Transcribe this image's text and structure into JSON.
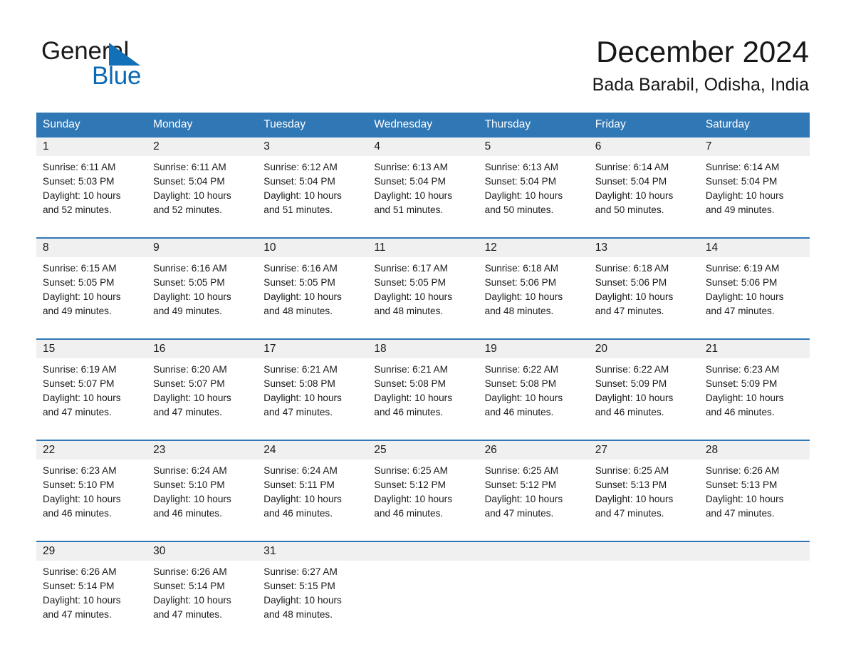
{
  "brand": {
    "name_part1": "General",
    "name_part2": "Blue",
    "triangle_color": "#1270b8",
    "blue_text_color": "#0b68b4"
  },
  "header": {
    "month_title": "December 2024",
    "location": "Bada Barabil, Odisha, India"
  },
  "theme": {
    "header_blue": "#2f77b5",
    "daynum_band": "#f0f0f0",
    "divider_blue": "#2f77b5",
    "text": "#1a1a1a"
  },
  "calendar": {
    "weekday_headers": [
      "Sunday",
      "Monday",
      "Tuesday",
      "Wednesday",
      "Thursday",
      "Friday",
      "Saturday"
    ],
    "weeks": [
      [
        {
          "day": "1",
          "sunrise": "Sunrise: 6:11 AM",
          "sunset": "Sunset: 5:03 PM",
          "daylight_line1": "Daylight: 10 hours",
          "daylight_line2": "and 52 minutes."
        },
        {
          "day": "2",
          "sunrise": "Sunrise: 6:11 AM",
          "sunset": "Sunset: 5:04 PM",
          "daylight_line1": "Daylight: 10 hours",
          "daylight_line2": "and 52 minutes."
        },
        {
          "day": "3",
          "sunrise": "Sunrise: 6:12 AM",
          "sunset": "Sunset: 5:04 PM",
          "daylight_line1": "Daylight: 10 hours",
          "daylight_line2": "and 51 minutes."
        },
        {
          "day": "4",
          "sunrise": "Sunrise: 6:13 AM",
          "sunset": "Sunset: 5:04 PM",
          "daylight_line1": "Daylight: 10 hours",
          "daylight_line2": "and 51 minutes."
        },
        {
          "day": "5",
          "sunrise": "Sunrise: 6:13 AM",
          "sunset": "Sunset: 5:04 PM",
          "daylight_line1": "Daylight: 10 hours",
          "daylight_line2": "and 50 minutes."
        },
        {
          "day": "6",
          "sunrise": "Sunrise: 6:14 AM",
          "sunset": "Sunset: 5:04 PM",
          "daylight_line1": "Daylight: 10 hours",
          "daylight_line2": "and 50 minutes."
        },
        {
          "day": "7",
          "sunrise": "Sunrise: 6:14 AM",
          "sunset": "Sunset: 5:04 PM",
          "daylight_line1": "Daylight: 10 hours",
          "daylight_line2": "and 49 minutes."
        }
      ],
      [
        {
          "day": "8",
          "sunrise": "Sunrise: 6:15 AM",
          "sunset": "Sunset: 5:05 PM",
          "daylight_line1": "Daylight: 10 hours",
          "daylight_line2": "and 49 minutes."
        },
        {
          "day": "9",
          "sunrise": "Sunrise: 6:16 AM",
          "sunset": "Sunset: 5:05 PM",
          "daylight_line1": "Daylight: 10 hours",
          "daylight_line2": "and 49 minutes."
        },
        {
          "day": "10",
          "sunrise": "Sunrise: 6:16 AM",
          "sunset": "Sunset: 5:05 PM",
          "daylight_line1": "Daylight: 10 hours",
          "daylight_line2": "and 48 minutes."
        },
        {
          "day": "11",
          "sunrise": "Sunrise: 6:17 AM",
          "sunset": "Sunset: 5:05 PM",
          "daylight_line1": "Daylight: 10 hours",
          "daylight_line2": "and 48 minutes."
        },
        {
          "day": "12",
          "sunrise": "Sunrise: 6:18 AM",
          "sunset": "Sunset: 5:06 PM",
          "daylight_line1": "Daylight: 10 hours",
          "daylight_line2": "and 48 minutes."
        },
        {
          "day": "13",
          "sunrise": "Sunrise: 6:18 AM",
          "sunset": "Sunset: 5:06 PM",
          "daylight_line1": "Daylight: 10 hours",
          "daylight_line2": "and 47 minutes."
        },
        {
          "day": "14",
          "sunrise": "Sunrise: 6:19 AM",
          "sunset": "Sunset: 5:06 PM",
          "daylight_line1": "Daylight: 10 hours",
          "daylight_line2": "and 47 minutes."
        }
      ],
      [
        {
          "day": "15",
          "sunrise": "Sunrise: 6:19 AM",
          "sunset": "Sunset: 5:07 PM",
          "daylight_line1": "Daylight: 10 hours",
          "daylight_line2": "and 47 minutes."
        },
        {
          "day": "16",
          "sunrise": "Sunrise: 6:20 AM",
          "sunset": "Sunset: 5:07 PM",
          "daylight_line1": "Daylight: 10 hours",
          "daylight_line2": "and 47 minutes."
        },
        {
          "day": "17",
          "sunrise": "Sunrise: 6:21 AM",
          "sunset": "Sunset: 5:08 PM",
          "daylight_line1": "Daylight: 10 hours",
          "daylight_line2": "and 47 minutes."
        },
        {
          "day": "18",
          "sunrise": "Sunrise: 6:21 AM",
          "sunset": "Sunset: 5:08 PM",
          "daylight_line1": "Daylight: 10 hours",
          "daylight_line2": "and 46 minutes."
        },
        {
          "day": "19",
          "sunrise": "Sunrise: 6:22 AM",
          "sunset": "Sunset: 5:08 PM",
          "daylight_line1": "Daylight: 10 hours",
          "daylight_line2": "and 46 minutes."
        },
        {
          "day": "20",
          "sunrise": "Sunrise: 6:22 AM",
          "sunset": "Sunset: 5:09 PM",
          "daylight_line1": "Daylight: 10 hours",
          "daylight_line2": "and 46 minutes."
        },
        {
          "day": "21",
          "sunrise": "Sunrise: 6:23 AM",
          "sunset": "Sunset: 5:09 PM",
          "daylight_line1": "Daylight: 10 hours",
          "daylight_line2": "and 46 minutes."
        }
      ],
      [
        {
          "day": "22",
          "sunrise": "Sunrise: 6:23 AM",
          "sunset": "Sunset: 5:10 PM",
          "daylight_line1": "Daylight: 10 hours",
          "daylight_line2": "and 46 minutes."
        },
        {
          "day": "23",
          "sunrise": "Sunrise: 6:24 AM",
          "sunset": "Sunset: 5:10 PM",
          "daylight_line1": "Daylight: 10 hours",
          "daylight_line2": "and 46 minutes."
        },
        {
          "day": "24",
          "sunrise": "Sunrise: 6:24 AM",
          "sunset": "Sunset: 5:11 PM",
          "daylight_line1": "Daylight: 10 hours",
          "daylight_line2": "and 46 minutes."
        },
        {
          "day": "25",
          "sunrise": "Sunrise: 6:25 AM",
          "sunset": "Sunset: 5:12 PM",
          "daylight_line1": "Daylight: 10 hours",
          "daylight_line2": "and 46 minutes."
        },
        {
          "day": "26",
          "sunrise": "Sunrise: 6:25 AM",
          "sunset": "Sunset: 5:12 PM",
          "daylight_line1": "Daylight: 10 hours",
          "daylight_line2": "and 47 minutes."
        },
        {
          "day": "27",
          "sunrise": "Sunrise: 6:25 AM",
          "sunset": "Sunset: 5:13 PM",
          "daylight_line1": "Daylight: 10 hours",
          "daylight_line2": "and 47 minutes."
        },
        {
          "day": "28",
          "sunrise": "Sunrise: 6:26 AM",
          "sunset": "Sunset: 5:13 PM",
          "daylight_line1": "Daylight: 10 hours",
          "daylight_line2": "and 47 minutes."
        }
      ],
      [
        {
          "day": "29",
          "sunrise": "Sunrise: 6:26 AM",
          "sunset": "Sunset: 5:14 PM",
          "daylight_line1": "Daylight: 10 hours",
          "daylight_line2": "and 47 minutes."
        },
        {
          "day": "30",
          "sunrise": "Sunrise: 6:26 AM",
          "sunset": "Sunset: 5:14 PM",
          "daylight_line1": "Daylight: 10 hours",
          "daylight_line2": "and 47 minutes."
        },
        {
          "day": "31",
          "sunrise": "Sunrise: 6:27 AM",
          "sunset": "Sunset: 5:15 PM",
          "daylight_line1": "Daylight: 10 hours",
          "daylight_line2": "and 48 minutes."
        },
        {
          "day": "",
          "sunrise": "",
          "sunset": "",
          "daylight_line1": "",
          "daylight_line2": ""
        },
        {
          "day": "",
          "sunrise": "",
          "sunset": "",
          "daylight_line1": "",
          "daylight_line2": ""
        },
        {
          "day": "",
          "sunrise": "",
          "sunset": "",
          "daylight_line1": "",
          "daylight_line2": ""
        },
        {
          "day": "",
          "sunrise": "",
          "sunset": "",
          "daylight_line1": "",
          "daylight_line2": ""
        }
      ]
    ]
  }
}
